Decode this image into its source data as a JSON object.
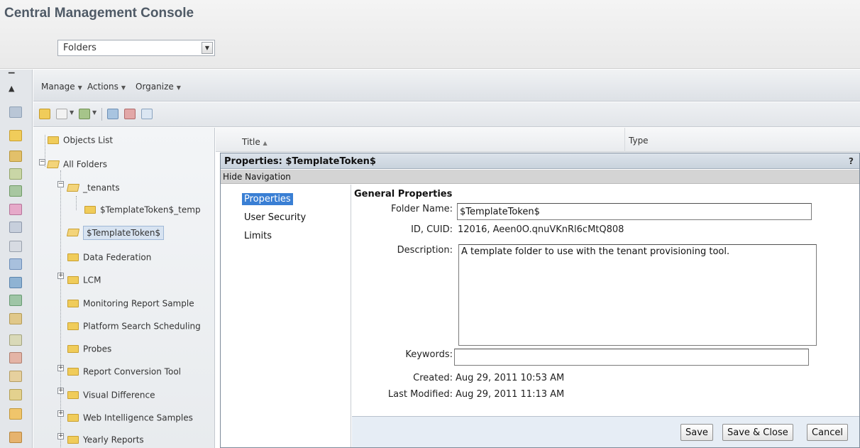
{
  "app": {
    "title": "Central Management Console"
  },
  "nav_select": {
    "value": "Folders"
  },
  "menubar": {
    "items": [
      "Manage",
      "Actions",
      "Organize"
    ]
  },
  "tree": {
    "items": [
      {
        "label": "Objects List"
      },
      {
        "label": "All Folders"
      },
      {
        "label": "_tenants"
      },
      {
        "label": "$TemplateToken$_temp"
      },
      {
        "label": "$TemplateToken$"
      },
      {
        "label": "Data Federation"
      },
      {
        "label": "LCM"
      },
      {
        "label": "Monitoring Report Sample"
      },
      {
        "label": "Platform Search Scheduling"
      },
      {
        "label": "Probes"
      },
      {
        "label": "Report Conversion Tool"
      },
      {
        "label": "Visual Difference"
      },
      {
        "label": "Web Intelligence Samples"
      },
      {
        "label": "Yearly Reports"
      }
    ]
  },
  "list": {
    "columns": [
      "Title",
      "Type"
    ]
  },
  "dialog": {
    "title": "Properties: $TemplateToken$",
    "help": "?",
    "hide_navigation": "Hide Navigation",
    "nav": [
      "Properties",
      "User Security",
      "Limits"
    ],
    "section": "General Properties",
    "fields": {
      "folder_name_label": "Folder Name:",
      "folder_name_value": "$TemplateToken$",
      "id_label": "ID, CUID:",
      "id_value": "12016, Aeen0O.qnuVKnRl6cMtQ808",
      "description_label": "Description:",
      "description_value": "A template folder to use with the tenant provisioning tool.",
      "keywords_label": "Keywords:",
      "keywords_value": "",
      "created_label": "Created:",
      "created_value": "Aug 29, 2011 10:53 AM",
      "modified_label": "Last Modified:",
      "modified_value": "Aug 29, 2011 11:13 AM"
    },
    "buttons": {
      "save": "Save",
      "save_close": "Save & Close",
      "cancel": "Cancel"
    }
  }
}
